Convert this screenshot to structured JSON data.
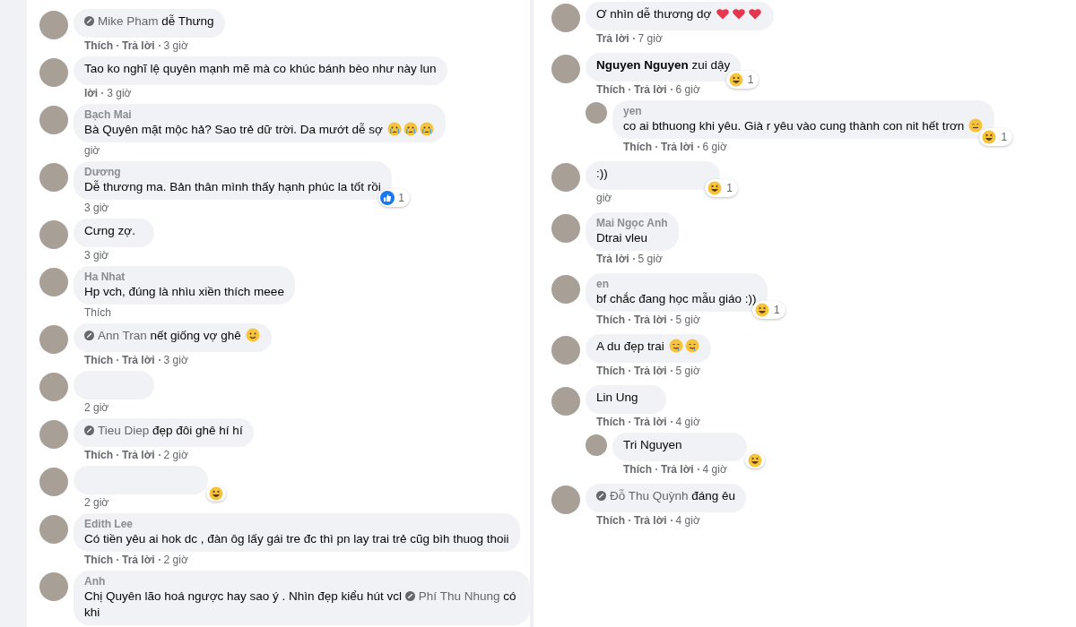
{
  "left_comments": [
    {
      "mention": {
        "name": "Mike Pham",
        "kind": "tag"
      },
      "text": "dễ Thưng",
      "meta": [
        "Thích",
        "Trả lời",
        "3 giờ"
      ]
    },
    {
      "text": "Tao ko nghĩ lệ quyên mạnh mẽ mà co khúc bánh bèo như này lun",
      "meta": [
        "lời",
        "3 giờ"
      ]
    },
    {
      "name": "Bạch Mai",
      "text": "Bà Quyên mặt mộc hả? Sao trẻ dữ trời. Da mướt dễ sợ",
      "emojis": [
        {
          "kind": "cry"
        },
        {
          "kind": "cry"
        },
        {
          "kind": "cry"
        }
      ],
      "meta": [
        "giờ"
      ]
    },
    {
      "name": "Dương",
      "text": "Dễ thương ma. Bản thân mình thấy hạnh phúc la tốt rồi",
      "reaction": {
        "kind": "like",
        "count": "1"
      },
      "meta": [
        "3 giờ"
      ]
    },
    {
      "text": "Cưng zợ.",
      "meta": [
        "3 giờ"
      ]
    },
    {
      "name": "Ha Nhat",
      "text": "Hp vch, đúng là nhìu xiền thích meee",
      "meta": [
        "Thích"
      ]
    },
    {
      "mention": {
        "name": "Ann Tran",
        "kind": "tag"
      },
      "text": "nết giống vợ ghê",
      "emojis": [
        {
          "kind": "smile"
        }
      ],
      "meta": [
        "Thích",
        "Trả lời",
        "3 giờ"
      ]
    },
    {
      "meta": [
        "2 giờ"
      ]
    },
    {
      "mention": {
        "name": "Tieu Diep",
        "kind": "tag"
      },
      "text": "đẹp đôi ghê hí hí",
      "meta": [
        "Thích",
        "Trả lời",
        "2 giờ"
      ]
    },
    {
      "reaction": {
        "kind": "haha"
      },
      "meta": [
        "2 giờ"
      ]
    },
    {
      "name": "Edith Lee",
      "text": "Có tiền yêu ai hok dc , đàn ôg lấy gái tre đc thì pn lay trai trẻ cũg bìh thuog thoii",
      "meta": [
        "Thích",
        "Trả lời",
        "2 giờ"
      ]
    },
    {
      "name": "Anh",
      "text": "Chị Quyên lão hoá ngược hay sao ý . Nhìn đẹp kiểu hút vcl",
      "mention_after": {
        "name": "Phí Thu Nhung",
        "kind": "tag"
      },
      "text_after": "có khi"
    }
  ],
  "right_comments": [
    {
      "text": "Ơ nhìn dễ thương dợ",
      "emojis": [
        {
          "kind": "heart"
        },
        {
          "kind": "heart"
        },
        {
          "kind": "heart"
        }
      ],
      "meta": [
        "Trả lời",
        "7 giờ"
      ]
    },
    {
      "mention": {
        "name": "Nguyen Nguyen",
        "kind": "bold"
      },
      "text": "zui dậy",
      "reaction": {
        "kind": "haha",
        "count": "1"
      },
      "meta": [
        "Thích",
        "Trả lời",
        "6 giờ"
      ],
      "replies": [
        {
          "name": "yen",
          "text": "co ai bthuong khi yêu. Già r yêu vào cung thành con nit hết trơn",
          "emojis": [
            {
              "kind": "grin"
            }
          ],
          "reaction": {
            "kind": "haha",
            "count": "1"
          },
          "meta": [
            "Thích",
            "Trả lời",
            "6 giờ"
          ]
        }
      ]
    },
    {
      "text": ":))",
      "reaction": {
        "kind": "haha",
        "count": "1"
      },
      "meta": [
        "giờ"
      ]
    },
    {
      "name": "Mai Ngọc Anh",
      "text": "Dtrai vleu",
      "meta": [
        "Trả lời",
        "5 giờ"
      ]
    },
    {
      "name": "en",
      "text": "bf chắc đang học mẫu giáo :))",
      "reaction": {
        "kind": "haha",
        "count": "1"
      },
      "meta": [
        "Thích",
        "Trả lời",
        "5 giờ"
      ]
    },
    {
      "text": "A du đẹp trai",
      "emojis": [
        {
          "kind": "drool"
        },
        {
          "kind": "drool"
        }
      ],
      "meta": [
        "Thích",
        "Trả lời",
        "5 giờ"
      ]
    },
    {
      "text": "Lin Ung",
      "meta": [
        "Thích",
        "Trả lời",
        "4 giờ"
      ],
      "replies": [
        {
          "mention": {
            "name": "Tri Nguyen",
            "kind": "plain"
          },
          "reaction": {
            "kind": "haha"
          },
          "meta": [
            "Thích",
            "Trả lời",
            "4 giờ"
          ]
        }
      ]
    },
    {
      "mention": {
        "name": "Đỗ Thu Quỳnh",
        "kind": "tag"
      },
      "text": "đáng êu",
      "meta": [
        "Thích",
        "Trả lời",
        "4 giờ"
      ]
    }
  ]
}
